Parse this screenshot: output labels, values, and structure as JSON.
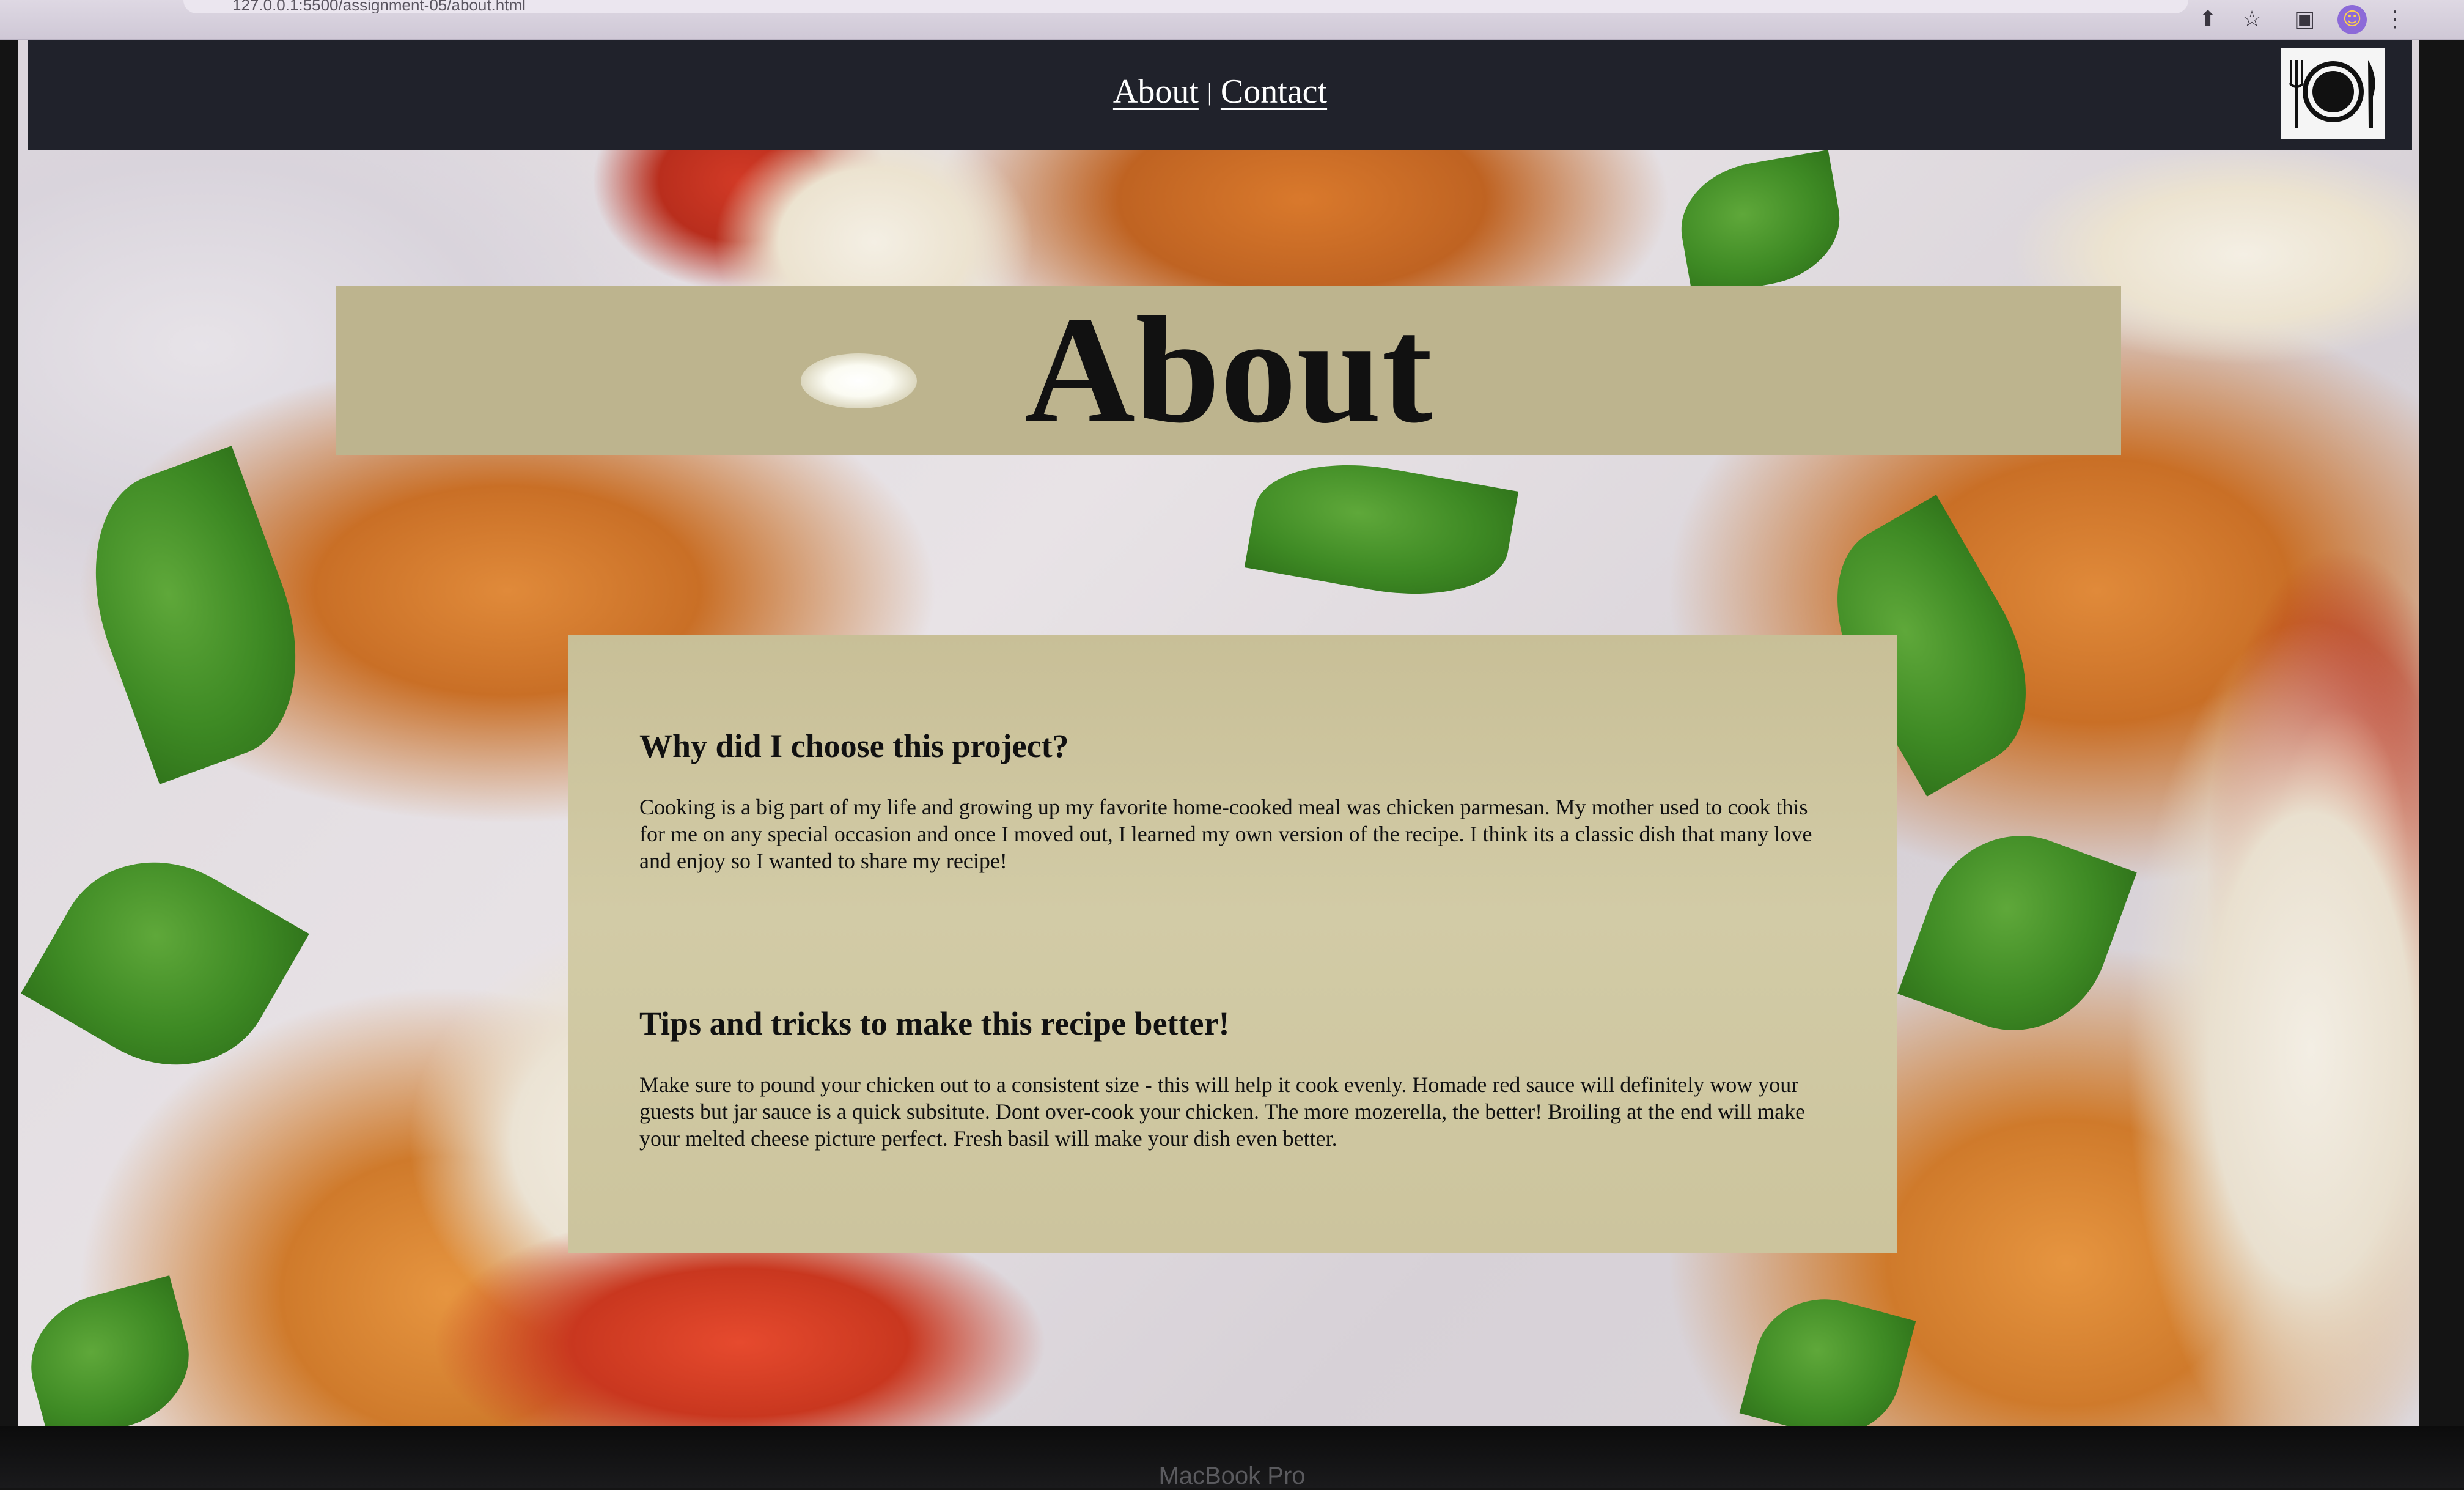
{
  "browser": {
    "url": "127.0.0.1:5500/assignment-05/about.html",
    "toolbar_icons": [
      "share-icon",
      "bookmark-star-icon",
      "side-panel-icon",
      "profile-avatar-icon",
      "more-menu-icon"
    ]
  },
  "nav": {
    "about_label": "About",
    "separator": "|",
    "contact_label": "Contact",
    "logo": "plate-fork-knife-icon"
  },
  "hero": {
    "title": "About"
  },
  "content": {
    "section1_heading": "Why did I choose this project?",
    "section1_text": "Cooking is a big part of my life and growing up my favorite home-cooked meal was chicken parmesan. My mother used to cook this for me on any special occasion and once I moved out, I learned my own version of the recipe. I think its a classic dish that many love and enjoy so I wanted to share my recipe!",
    "section2_heading": "Tips and tricks to make this recipe better!",
    "section2_text": "Make sure to pound your chicken out to a consistent size - this will help it cook evenly. Homade red sauce will definitely wow your guests but jar sauce is a quick subsitute. Dont over-cook your chicken. The more mozerella, the better! Broiling at the end will make your melted cheese picture perfect. Fresh basil will make your dish even better."
  },
  "device": {
    "label": "MacBook Pro"
  },
  "colors": {
    "navbar": "#20222b",
    "band": "#bdb48e",
    "card": "#d2cba6",
    "text": "#111111"
  }
}
